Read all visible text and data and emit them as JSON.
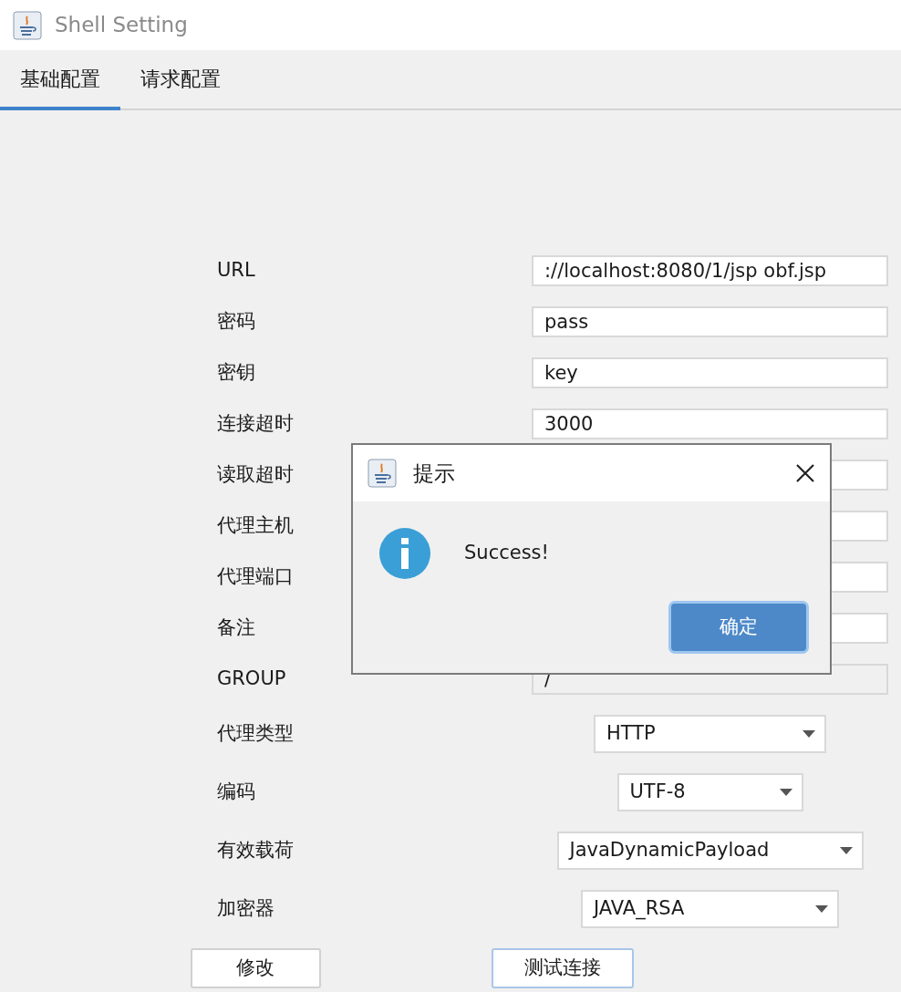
{
  "window": {
    "title": "Shell Setting"
  },
  "tabs": [
    {
      "label": "基础配置",
      "selected": true
    },
    {
      "label": "请求配置",
      "selected": false
    }
  ],
  "fields": [
    {
      "label": "URL",
      "value": "://localhost:8080/1/jsp obf.jsp",
      "disabled": false
    },
    {
      "label": "密码",
      "value": "pass",
      "disabled": false
    },
    {
      "label": "密钥",
      "value": "key",
      "disabled": false
    },
    {
      "label": "连接超时",
      "value": "3000",
      "disabled": false
    },
    {
      "label": "读取超时",
      "disabled": false
    },
    {
      "label": "代理主机",
      "disabled": false
    },
    {
      "label": "代理端口",
      "disabled": false
    },
    {
      "label": "备注",
      "disabled": false
    },
    {
      "label": "GROUP",
      "value": "/",
      "disabled": true
    }
  ],
  "selects": [
    {
      "label": "代理类型",
      "value": "HTTP"
    },
    {
      "label": "编码",
      "value": "UTF-8"
    },
    {
      "label": "有效载荷",
      "value": "JavaDynamicPayload"
    },
    {
      "label": "加密器",
      "value": "JAVA_RSA"
    }
  ],
  "buttons": [
    {
      "label": "修改",
      "focused": false
    },
    {
      "label": "测试连接",
      "focused": true
    }
  ],
  "dialog": {
    "title": "提示",
    "message": "Success!",
    "button": {
      "label": "确定",
      "focused": true
    }
  }
}
